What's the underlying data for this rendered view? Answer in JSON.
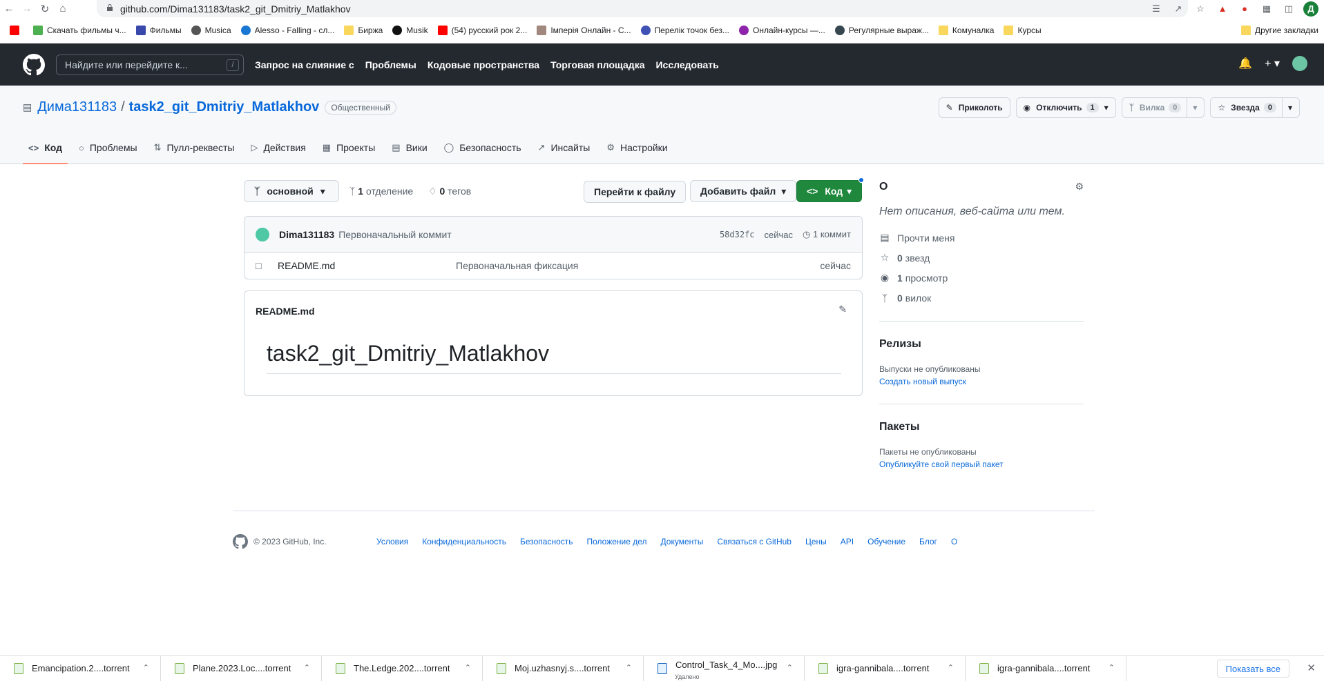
{
  "browser": {
    "url": "github.com/Dima131183/task2_git_Dmitriy_Matlakhov",
    "profile_initial": "Д",
    "bookmarks": [
      "Скачать фильмы ч...",
      "Фильмы",
      "Musica",
      "Alesso - Falling - сл...",
      "Биржа",
      "Musik",
      "(54) русский рок 2...",
      "Імперія Онлайн - С...",
      "Перелік точок без...",
      "Онлайн-курсы —...",
      "Регулярные выраж...",
      "Комуналка",
      "Курсы"
    ],
    "other_bookmarks": "Другие закладки"
  },
  "gh": {
    "search_placeholder": "Найдите или перейдите к...",
    "search_kbd": "/",
    "nav": [
      "Запрос на слияние с",
      "Проблемы",
      "Кодовые пространства",
      "Торговая площадка",
      "Исследовать"
    ]
  },
  "repo": {
    "owner": "Дима131183",
    "sep": "/",
    "name": "task2_git_Dmitriy_Matlakhov",
    "visibility": "Общественный",
    "pin": "Приколоть",
    "watch": "Отключить",
    "watch_count": "1",
    "fork": "Вилка",
    "fork_count": "0",
    "star": "Звезда",
    "star_count": "0",
    "tabs": [
      "Код",
      "Проблемы",
      "Пулл-реквесты",
      "Действия",
      "Проекты",
      "Вики",
      "Безопасность",
      "Инсайты",
      "Настройки"
    ]
  },
  "toolbar": {
    "branch": "основной",
    "branches_count": "1",
    "branches_label": "отделение",
    "tags_count": "0",
    "tags_label": "тегов",
    "goto_file": "Перейти к файлу",
    "add_file": "Добавить файл",
    "code": "Код"
  },
  "commit": {
    "author": "Dima131183",
    "message": "Первоначальный коммит",
    "sha": "58d32fc",
    "time": "сейчас",
    "count": "1 коммит"
  },
  "files": [
    {
      "name": "README.md",
      "message": "Первоначальная фиксация",
      "date": "сейчас"
    }
  ],
  "readme": {
    "title": "README.md",
    "heading": "task2_git_Dmitriy_Matlakhov"
  },
  "about": {
    "title": "О",
    "desc": "Нет описания, веб-сайта или тем.",
    "readme": "Прочти меня",
    "stars": "0",
    "stars_label": "звезд",
    "watch": "1",
    "watch_label": "просмотр",
    "forks": "0",
    "forks_label": "вилок",
    "releases_title": "Релизы",
    "releases_none": "Выпуски не опубликованы",
    "releases_link": "Создать новый выпуск",
    "packages_title": "Пакеты",
    "packages_none": "Пакеты не опубликованы",
    "packages_link": "Опубликуйте свой первый пакет"
  },
  "footer": {
    "copyright": "© 2023 GitHub, Inc.",
    "links": [
      "Условия",
      "Конфиденциальность",
      "Безопасность",
      "Положение дел",
      "Документы",
      "Связаться с GitHub",
      "Цены",
      "API",
      "Обучение",
      "Блог",
      "О"
    ]
  },
  "downloads": {
    "items": [
      {
        "name": "Emancipation.2....torrent",
        "sub": ""
      },
      {
        "name": "Plane.2023.Loc....torrent",
        "sub": ""
      },
      {
        "name": "The.Ledge.202....torrent",
        "sub": ""
      },
      {
        "name": "Moj.uzhasnyj.s....torrent",
        "sub": ""
      },
      {
        "name": "Control_Task_4_Mo....jpg",
        "sub": "Удалено"
      },
      {
        "name": "igra-gannibala....torrent",
        "sub": ""
      },
      {
        "name": "igra-gannibala....torrent",
        "sub": ""
      }
    ],
    "show_all": "Показать все"
  }
}
